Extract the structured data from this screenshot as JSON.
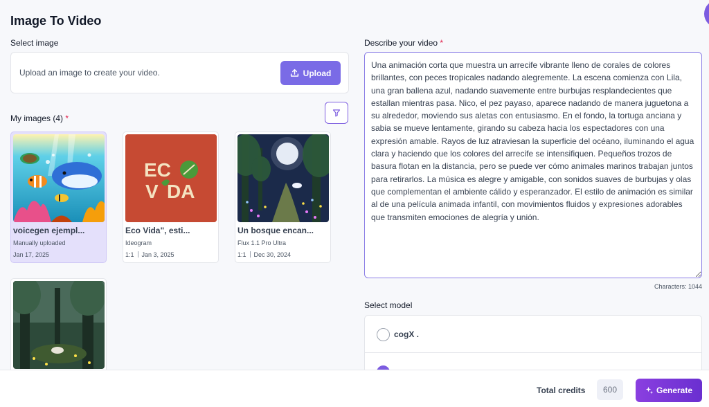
{
  "page": {
    "title": "Image To Video"
  },
  "select_image": {
    "label": "Select image",
    "upload_text": "Upload an image to create your video.",
    "upload_button": "Upload"
  },
  "my_images": {
    "label": "My images (4)",
    "required_mark": "*",
    "cards": [
      {
        "title": "voicegen ejempl...",
        "subtitle": "Manually uploaded",
        "date": "Jan 17, 2025",
        "ratio": "",
        "selected": true
      },
      {
        "title": "Eco Vida\", esti...",
        "subtitle": "Ideogram",
        "ratio": "1:1",
        "date": "Jan 3, 2025",
        "logo_line1": "ECO",
        "logo_line2": "VIDA"
      },
      {
        "title": "Un bosque encan...",
        "subtitle": "Flux 1.1 Pro Ultra",
        "ratio": "1:1",
        "date": "Dec 30, 2024"
      }
    ]
  },
  "describe": {
    "label": "Describe your video",
    "required_mark": "*",
    "text": "Una animación corta que muestra un arrecife vibrante lleno de corales de colores brillantes, con peces tropicales nadando alegremente. La escena comienza con Lila, una gran ballena azul, nadando suavemente entre burbujas resplandecientes que estallan mientras pasa. Nico, el pez payaso, aparece nadando de manera juguetona a su alrededor, moviendo sus aletas con entusiasmo. En el fondo, la tortuga anciana y sabia se mueve lentamente, girando su cabeza hacia los espectadores con una expresión amable. Rayos de luz atraviesan la superficie del océano, iluminando el agua clara y haciendo que los colores del arrecife se intensifiquen. Pequeños trozos de basura flotan en la distancia, pero se puede ver cómo animales marinos trabajan juntos para retirarlos. La música es alegre y amigable, con sonidos suaves de burbujas y olas que complementan el ambiente cálido y esperanzador. El estilo de animación es similar al de una película animada infantil, con movimientos fluidos y expresiones adorables que transmiten emociones de alegría y unión.",
    "characters": "Characters: 1044"
  },
  "model": {
    "label": "Select model",
    "options": [
      {
        "label": "cogX .",
        "selected": false
      }
    ]
  },
  "footer": {
    "credits_label": "Total credits",
    "credits_value": "600",
    "generate": "Generate"
  },
  "colors": {
    "accent": "#7a6be6",
    "generate_start": "#8a3fe0",
    "generate_end": "#6a2fd0",
    "required": "#e11d48"
  }
}
